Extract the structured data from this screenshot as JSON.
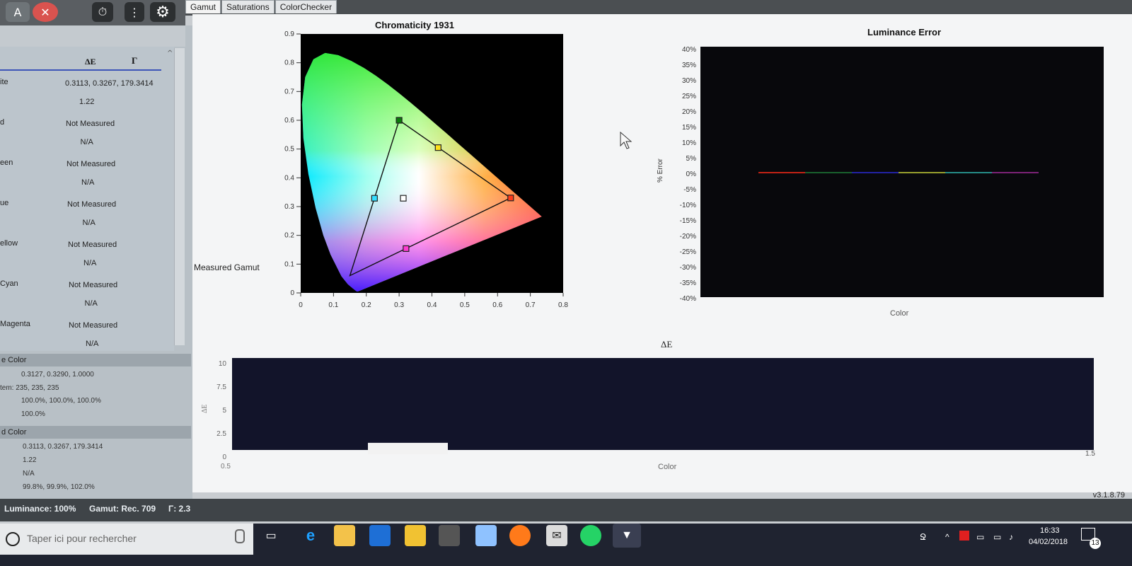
{
  "toolbar": {
    "btn_a": "A",
    "btn_x": "✕",
    "btn_timer": "⏱",
    "btn_more": "⋮",
    "btn_gear": "⚙"
  },
  "tabs": [
    "Gamut",
    "Saturations",
    "ColorChecker"
  ],
  "left_table": {
    "header_de": "ΔE",
    "header_gamma": "Γ",
    "rows": [
      {
        "label": "ite",
        "value": "0.3113, 0.3267, 179.3414",
        "sub": "1.22"
      },
      {
        "label": "d",
        "value": "Not Measured",
        "sub": "N/A"
      },
      {
        "label": "een",
        "value": "Not Measured",
        "sub": "N/A"
      },
      {
        "label": "ue",
        "value": "Not Measured",
        "sub": "N/A"
      },
      {
        "label": "ellow",
        "value": "Not Measured",
        "sub": "N/A"
      },
      {
        "label": "Cyan",
        "value": "Not Measured",
        "sub": "N/A"
      },
      {
        "label": "Magenta",
        "value": "Not Measured",
        "sub": "N/A"
      }
    ]
  },
  "target_color": {
    "title": "e Color",
    "line1": "0.3127, 0.3290, 1.0000",
    "line2": "tem: 235, 235, 235",
    "line3": "100.0%, 100.0%, 100.0%",
    "line4": "100.0%"
  },
  "measured_color": {
    "title": "d Color",
    "line1": "0.3113, 0.3267, 179.3414",
    "line2": "1.22",
    "line3": "N/A",
    "line4": "99.8%, 99.9%, 102.0%"
  },
  "chromaticity": {
    "title": "Chromaticity 1931",
    "side_label": "Measured Gamut",
    "xticks": [
      "0",
      "0.1",
      "0.2",
      "0.3",
      "0.4",
      "0.5",
      "0.6",
      "0.7",
      "0.8"
    ],
    "yticks": [
      "0",
      "0.1",
      "0.2",
      "0.3",
      "0.4",
      "0.5",
      "0.6",
      "0.7",
      "0.8",
      "0.9"
    ],
    "xlim": [
      0,
      0.8
    ],
    "ylim": [
      0,
      0.9
    ],
    "triangle_outer": [
      [
        0.64,
        0.33
      ],
      [
        0.3,
        0.6
      ],
      [
        0.15,
        0.06
      ]
    ],
    "markers": [
      {
        "x": 0.64,
        "y": 0.33,
        "color": "#ff3a1a"
      },
      {
        "x": 0.3,
        "y": 0.6,
        "color": "#0a7a0a"
      },
      {
        "x": 0.225,
        "y": 0.329,
        "color": "#33dfff"
      },
      {
        "x": 0.419,
        "y": 0.505,
        "color": "#ffe11a"
      },
      {
        "x": 0.321,
        "y": 0.154,
        "color": "#ff3ad2"
      },
      {
        "x": 0.3127,
        "y": 0.329,
        "color": "#ffffff"
      }
    ]
  },
  "luminance": {
    "title": "Luminance Error",
    "ylabel": "% Error",
    "xlabel": "Color",
    "yticks": [
      "40%",
      "35%",
      "30%",
      "25%",
      "20%",
      "15%",
      "10%",
      "5%",
      "0%",
      "-5%",
      "-10%",
      "-15%",
      "-20%",
      "-25%",
      "-30%",
      "-35%",
      "-40%"
    ],
    "series_colors": [
      "#ff2a1a",
      "#1f7d3a",
      "#2b2bd8",
      "#c8d23a",
      "#2fb7b0",
      "#a22a9a"
    ]
  },
  "deltae": {
    "title": "ΔE",
    "ylabel": "ΔE",
    "xlabel": "Color",
    "yticks": [
      "10",
      "7.5",
      "5",
      "2.5",
      "0"
    ],
    "x_left": "0.5",
    "x_right": "1.5"
  },
  "chart_data": [
    {
      "type": "scatter",
      "title": "Chromaticity 1931",
      "xlim": [
        0,
        0.8
      ],
      "ylim": [
        0,
        0.9
      ],
      "points": [
        {
          "x": 0.64,
          "y": 0.33
        },
        {
          "x": 0.3,
          "y": 0.6
        },
        {
          "x": 0.225,
          "y": 0.329
        },
        {
          "x": 0.419,
          "y": 0.505
        },
        {
          "x": 0.321,
          "y": 0.154
        },
        {
          "x": 0.3127,
          "y": 0.329
        }
      ]
    },
    {
      "type": "line",
      "title": "Luminance Error",
      "ylabel": "% Error",
      "xlabel": "Color",
      "ylim": [
        -40,
        40
      ],
      "values": [
        0,
        0,
        0,
        0,
        0,
        0
      ]
    },
    {
      "type": "bar",
      "title": "ΔE",
      "xlabel": "Color",
      "ylim": [
        0,
        10
      ],
      "values": [
        1.22
      ]
    }
  ],
  "statusbar": {
    "luminance": "Luminance: 100%",
    "gamut": "Gamut: Rec. 709",
    "gamma": "Γ: 2.3",
    "version": "v3.1.8.79"
  },
  "taskbar": {
    "search_placeholder": "Taper ici pour rechercher",
    "time": "16:33",
    "date": "04/02/2018",
    "badge": "13"
  }
}
